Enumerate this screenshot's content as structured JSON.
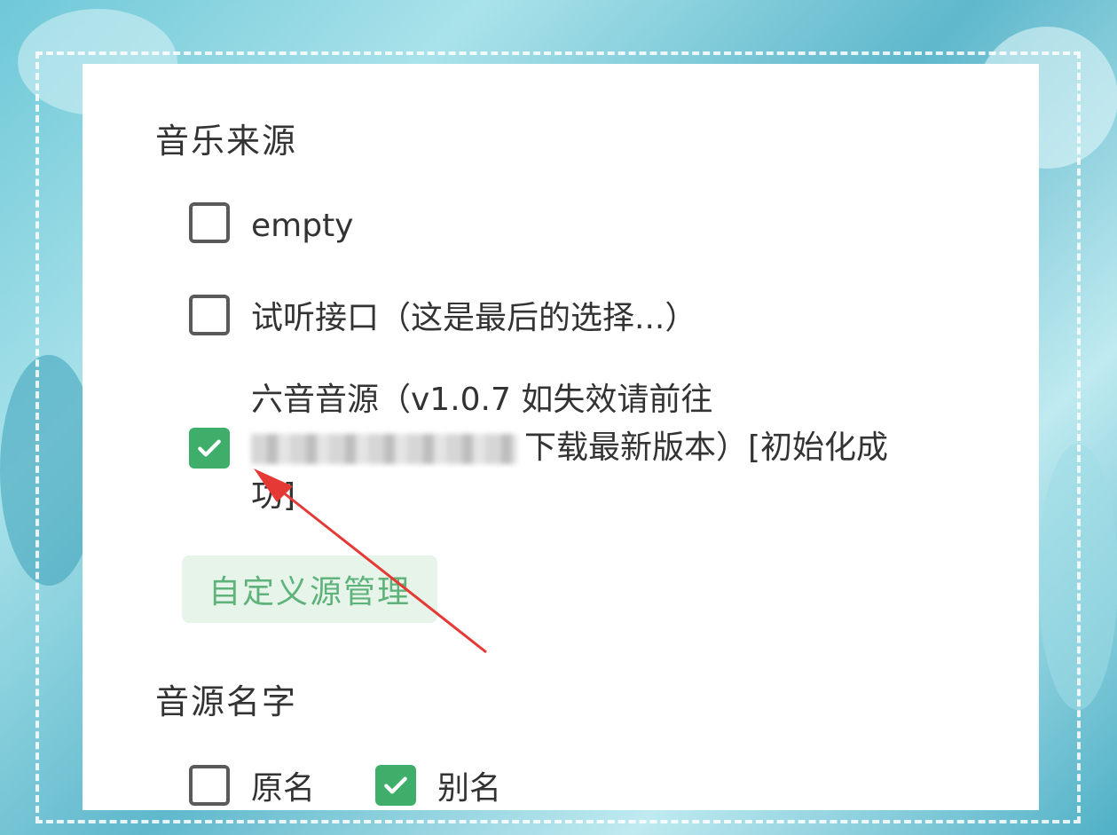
{
  "colors": {
    "accent_green": "#3fae6b",
    "button_bg": "#e6f4ea",
    "button_text": "#5fb27a",
    "annotation_arrow": "#e53935"
  },
  "music_source": {
    "title": "音乐来源",
    "options": [
      {
        "label": "empty",
        "checked": false
      },
      {
        "label": "试听接口（这是最后的选择...）",
        "checked": false
      },
      {
        "label_line1": "六音音源（v1.0.7 如失效请前往",
        "label_line2_suffix": "下载最新版本）[初始化成",
        "label_line3": "功]",
        "checked": true
      }
    ],
    "manage_button": "自定义源管理"
  },
  "source_name": {
    "title": "音源名字",
    "options": [
      {
        "label": "原名",
        "checked": false
      },
      {
        "label": "别名",
        "checked": true
      }
    ]
  }
}
